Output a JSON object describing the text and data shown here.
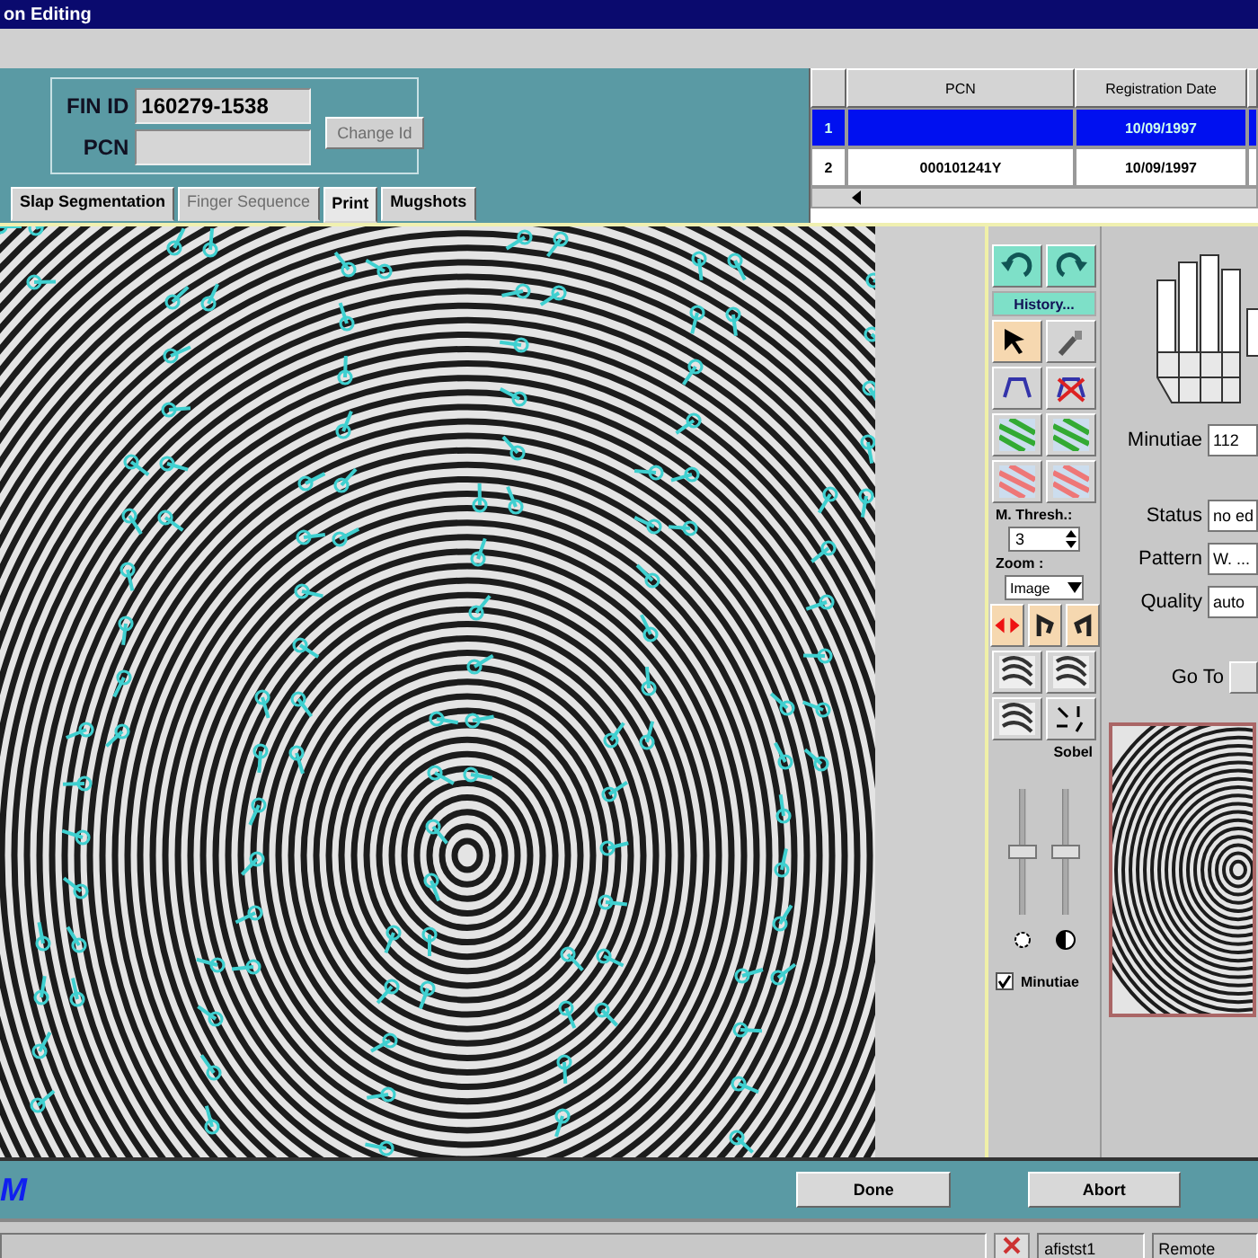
{
  "window": {
    "title": "on Editing"
  },
  "id_panel": {
    "fields": [
      {
        "label": "FIN ID",
        "value": "160279-1538"
      },
      {
        "label": "PCN"
      }
    ],
    "change_button": {
      "label": "Change Id",
      "disabled": true
    }
  },
  "records": {
    "columns": [
      "PCN",
      "Registration Date"
    ],
    "rows": [
      {
        "index": "1",
        "date": "10/09/1997",
        "selected": true
      },
      {
        "index": "2",
        "pcn": "000101241Y",
        "date": "10/09/1997",
        "selected": false
      }
    ]
  },
  "tabs": [
    {
      "label": "Slap Segmentation",
      "selected": false,
      "disabled": false
    },
    {
      "label": "Finger Sequence",
      "selected": false,
      "disabled": true
    },
    {
      "label": "Print",
      "selected": true,
      "disabled": false
    },
    {
      "label": "Mugshots",
      "selected": false,
      "disabled": false
    }
  ],
  "toolbar": {
    "history": "History...",
    "thresh_label": "M. Thresh.:",
    "thresh_value": "3",
    "zoom_label": "Zoom :",
    "zoom_value": "Image",
    "sobel_label": "Sobel",
    "sliders": [
      {
        "level": 0.5
      },
      {
        "level": 0.5
      }
    ],
    "minutiae": {
      "label": "Minutiae",
      "checked": true
    }
  },
  "details": {
    "fields": [
      {
        "label": "Minutiae",
        "value": "112"
      },
      {
        "label": "Status",
        "value": "no ed"
      },
      {
        "label": "Pattern",
        "value": "W. ..."
      },
      {
        "label": "Quality",
        "value": "auto"
      }
    ],
    "goto": "Go To"
  },
  "footer": {
    "logo": "M",
    "buttons": [
      "Done",
      "Abort"
    ]
  },
  "status_bar": {
    "user": "afistst1",
    "mode": "Remote"
  }
}
